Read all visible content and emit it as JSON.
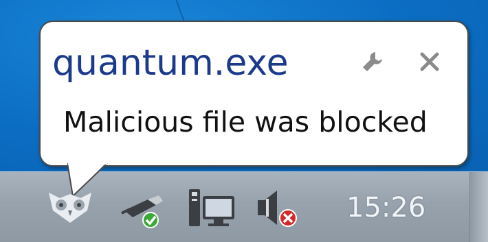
{
  "notification": {
    "title": "quantum.exe",
    "message": "Malicious file was blocked",
    "options_icon": "wrench-icon",
    "close_icon": "close-icon",
    "title_color": "#1c3a8c"
  },
  "tray": {
    "icons": [
      {
        "name": "owl-antivirus-icon"
      },
      {
        "name": "usb-device-icon"
      },
      {
        "name": "network-icon"
      },
      {
        "name": "volume-muted-icon"
      }
    ],
    "clock": "15:26"
  }
}
